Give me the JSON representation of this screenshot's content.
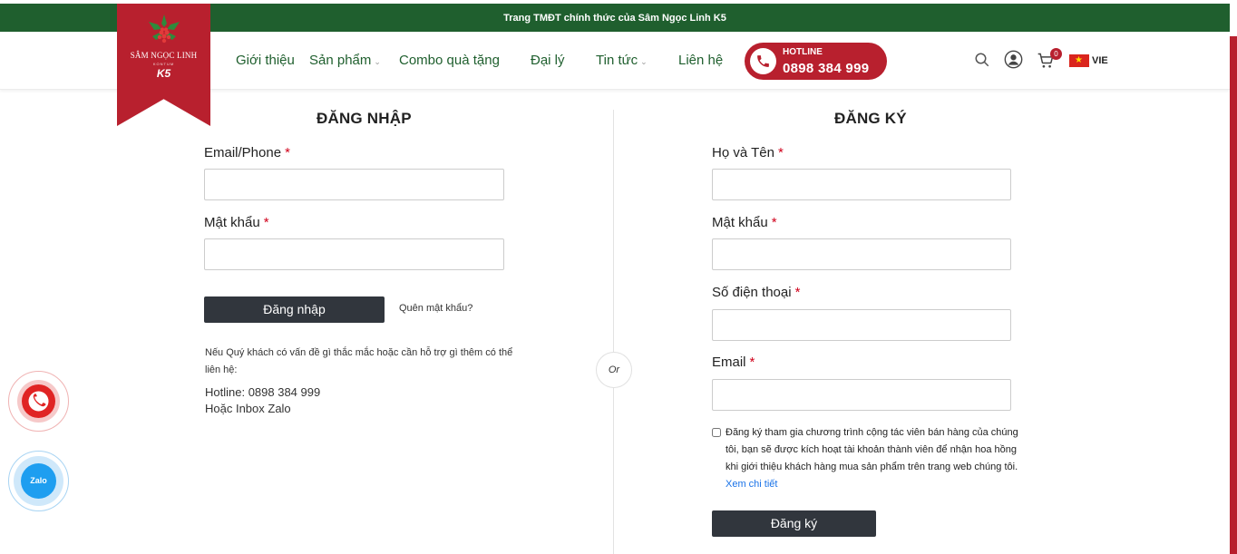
{
  "topbar": {
    "text": "Trang TMĐT chính thức của Sâm Ngọc Linh K5"
  },
  "logo": {
    "brand": "SÂM NGỌC LINH",
    "sub": "KONTUM",
    "mark": "K5"
  },
  "nav": {
    "items": [
      {
        "label": "Giới thiệu"
      },
      {
        "label": "Sản phẩm"
      },
      {
        "label": "Combo quà tặng"
      },
      {
        "label": "Đại lý"
      },
      {
        "label": "Tin tức"
      },
      {
        "label": "Liên hệ"
      }
    ]
  },
  "hotline": {
    "label": "HOTLINE",
    "number": "0898 384 999"
  },
  "header_icons": {
    "search": "search-icon",
    "account": "user-icon",
    "cart": "cart-icon",
    "cart_count": "0"
  },
  "language": {
    "code": "VIE",
    "flag": "vietnam-flag"
  },
  "login": {
    "title": "ĐĂNG NHẬP",
    "email_label": "Email/Phone",
    "password_label": "Mật khẩu",
    "required_mark": "*",
    "submit_label": "Đăng nhập",
    "forgot_label": "Quên mật khẩu?",
    "help_text": "Nếu Quý khách có vấn đề gì thắc mắc hoặc cần hỗ trợ gì thêm có thể liên hệ:",
    "hotline_text": "Hotline: 0898 384 999",
    "zalo_text": "Hoặc Inbox Zalo"
  },
  "divider": {
    "or_label": "Or"
  },
  "register": {
    "title": "ĐĂNG KÝ",
    "name_label": "Họ và Tên",
    "password_label": "Mật khẩu",
    "phone_label": "Số điện thoại",
    "email_label": "Email",
    "required_mark": "*",
    "agree_text": "Đăng ký tham gia chương trình cộng tác viên bán hàng của chúng tôi, bạn sẽ được kích hoạt tài khoản thành viên để nhận hoa hồng khi giới thiệu khách hàng mua sản phẩm trên trang web chúng tôi.",
    "agree_link": "Xem chi tiết",
    "submit_label": "Đăng ký"
  },
  "floating": {
    "phone": "phone-icon",
    "zalo_label": "Zalo"
  },
  "colors": {
    "brand_green": "#1f5f2e",
    "brand_red": "#b8202e",
    "button_dark": "#31363d",
    "link_blue": "#1a73e8"
  }
}
